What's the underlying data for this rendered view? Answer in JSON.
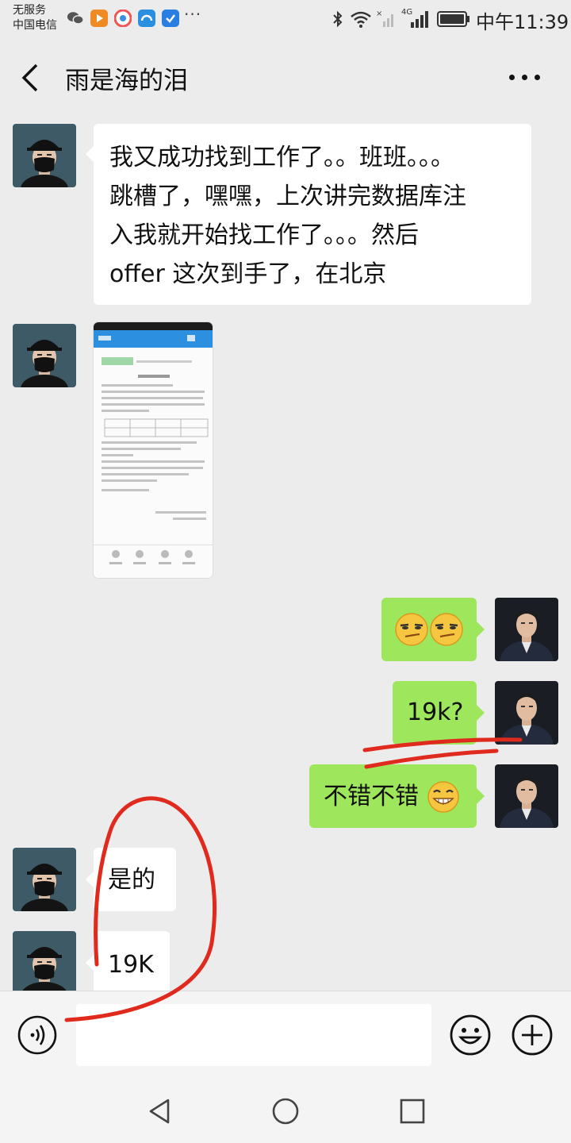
{
  "status_bar": {
    "carrier_line1": "无服务",
    "carrier_line2": "中国电信",
    "more": "···",
    "network": "4G",
    "time": "中午11:39"
  },
  "header": {
    "title": "雨是海的泪",
    "back_icon": "chevron-left-icon",
    "more_icon": "more-horizontal-icon"
  },
  "messages": [
    {
      "side": "left",
      "type": "text",
      "lines": [
        "我又成功找到工作了。。班班。。。",
        "跳槽了，嘿嘿，上次讲完数据库注",
        "入我就开始找工作了。。。然后",
        "offer 这次到手了，在北京"
      ]
    },
    {
      "side": "left",
      "type": "image",
      "description_icon": "document-screenshot-icon"
    },
    {
      "side": "right",
      "type": "emoji",
      "emoji_icon": "smirk-emoji-icon"
    },
    {
      "side": "right",
      "type": "text",
      "text": "19k?"
    },
    {
      "side": "right",
      "type": "text",
      "text": "不错不错",
      "emoji_icon": "grin-emoji-icon"
    },
    {
      "side": "left",
      "type": "text",
      "text": "是的"
    },
    {
      "side": "left",
      "type": "text",
      "text": "19K"
    }
  ],
  "input_bar": {
    "voice_icon": "voice-input-icon",
    "message_value": "",
    "emoji_icon": "emoji-picker-icon",
    "plus_icon": "plus-circle-icon"
  },
  "nav_bar": {
    "back_icon": "triangle-back-icon",
    "home_icon": "circle-home-icon",
    "recents_icon": "square-recents-icon"
  },
  "colors": {
    "background": "#ececec",
    "bubble_self": "#9ee75d",
    "bubble_other": "#ffffff",
    "annotation": "#e02a1e"
  }
}
